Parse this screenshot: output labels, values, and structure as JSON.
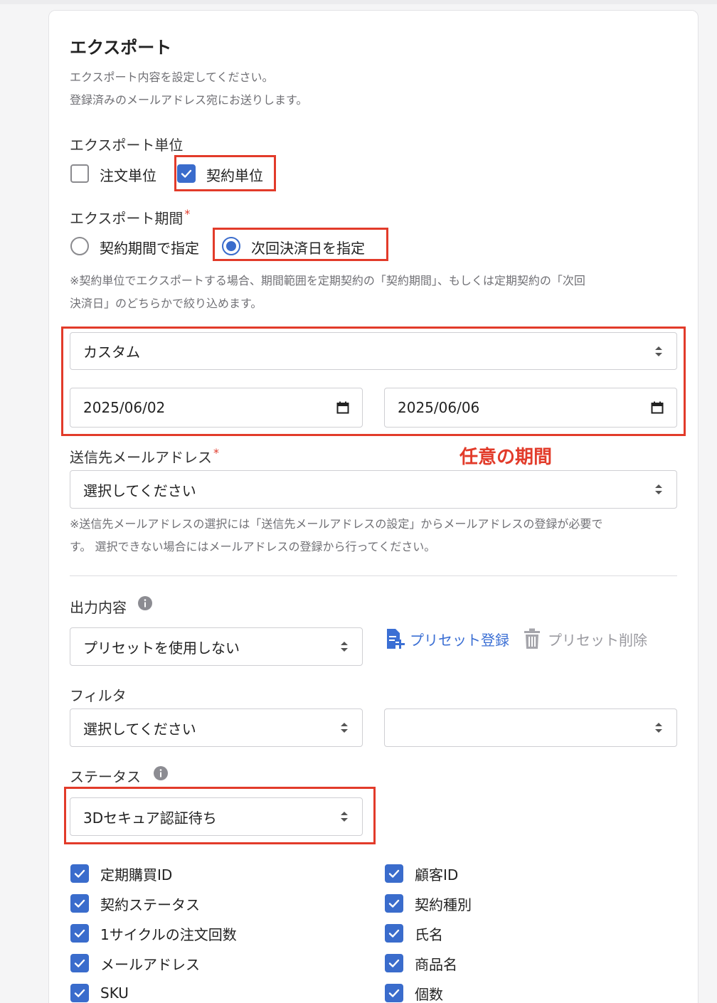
{
  "page": {
    "title": "エクスポート",
    "description_lines": [
      "エクスポート内容を設定してください。",
      "登録済みのメールアドレス宛にお送りします。"
    ]
  },
  "export_unit": {
    "label": "エクスポート単位",
    "options": [
      {
        "label": "注文単位",
        "checked": false
      },
      {
        "label": "契約単位",
        "checked": true
      }
    ]
  },
  "export_period": {
    "label": "エクスポート期間",
    "required_mark": "*",
    "options": [
      {
        "label": "契約期間で指定",
        "selected": false
      },
      {
        "label": "次回決済日を指定",
        "selected": true
      }
    ],
    "note_lines": [
      "※契約単位でエクスポートする場合、期間範囲を定期契約の「契約期間」、もしくは定期契約の「次回",
      "決済日」のどちらかで絞り込めます。"
    ],
    "range_select": "カスタム",
    "date_from": "2025/06/02",
    "date_to": "2025/06/06",
    "annotation": "任意の期間"
  },
  "email": {
    "label": "送信先メールアドレス",
    "required_mark": "*",
    "select_value": "選択してください",
    "note_lines": [
      "※送信先メールアドレスの選択には「送信先メールアドレスの設定」からメールアドレスの登録が必要で",
      "す。 選択できない場合にはメールアドレスの登録から行ってください。"
    ]
  },
  "output": {
    "label": "出力内容",
    "preset_select": "プリセットを使用しない",
    "preset_register": "プリセット登録",
    "preset_delete": "プリセット削除"
  },
  "filter": {
    "label": "フィルタ",
    "select1": "選択してください",
    "select2": ""
  },
  "status": {
    "label": "ステータス",
    "select_value": "3Dセキュア認証待ち"
  },
  "fields": {
    "left": [
      "定期購買ID",
      "契約ステータス",
      "1サイクルの注文回数",
      "メールアドレス",
      "SKU"
    ],
    "right": [
      "顧客ID",
      "契約種別",
      "氏名",
      "商品名",
      "個数"
    ]
  },
  "colors": {
    "accent": "#3a6ccc",
    "annotation_red": "#e23b2a"
  }
}
